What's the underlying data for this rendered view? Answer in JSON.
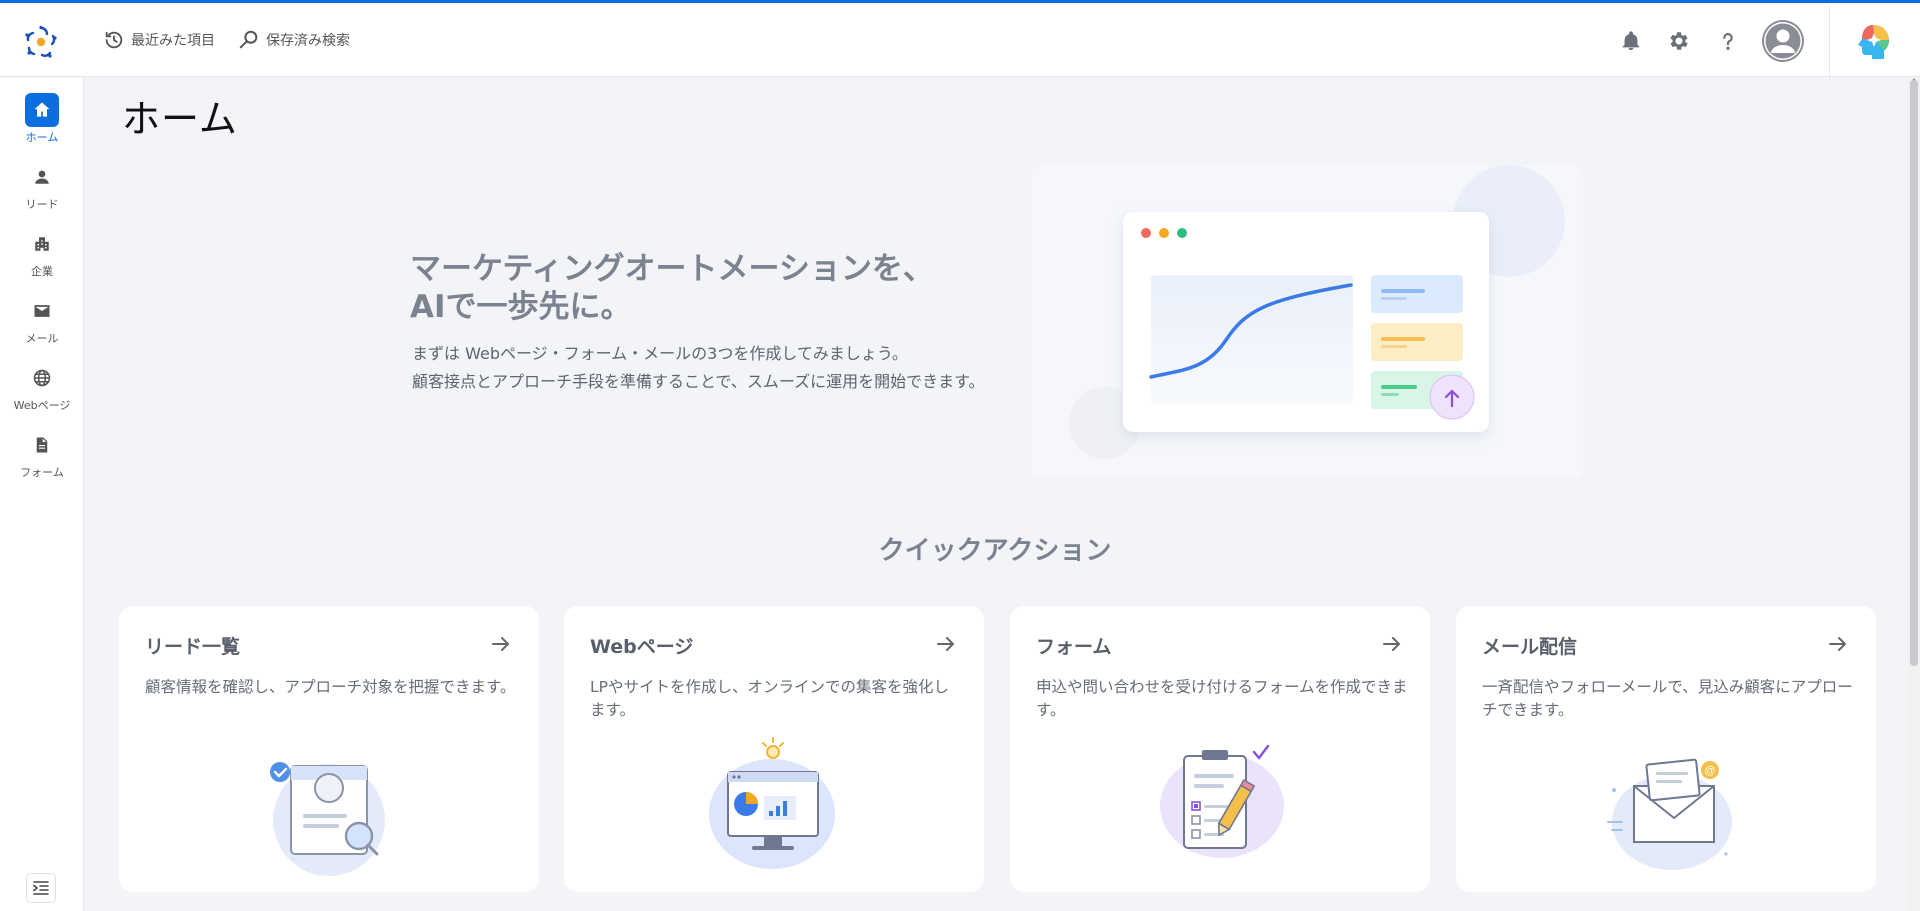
{
  "topbar": {
    "recent_label": "最近みた項目",
    "saved_search_label": "保存済み検索"
  },
  "sidebar": {
    "items": [
      {
        "label": "ホーム",
        "icon": "home-icon"
      },
      {
        "label": "リード",
        "icon": "person-icon"
      },
      {
        "label": "企業",
        "icon": "building-icon"
      },
      {
        "label": "メール",
        "icon": "mail-icon"
      },
      {
        "label": "Webページ",
        "icon": "globe-icon"
      },
      {
        "label": "フォーム",
        "icon": "document-icon"
      }
    ]
  },
  "page": {
    "title": "ホーム"
  },
  "hero": {
    "title_line1": "マーケティングオートメーションを、",
    "title_line2": "AIで一歩先に。",
    "desc_line1": "まずは Webページ・フォーム・メールの3つを作成してみましょう。",
    "desc_line2": "顧客接点とアプローチ手段を準備することで、スムーズに運用を開始できます。"
  },
  "quick_actions": {
    "title": "クイックアクション",
    "cards": [
      {
        "title": "リード一覧",
        "desc": "顧客情報を確認し、アプローチ対象を把握できます。"
      },
      {
        "title": "Webページ",
        "desc": "LPやサイトを作成し、オンラインでの集客を強化します。"
      },
      {
        "title": "フォーム",
        "desc": "申込や問い合わせを受け付けるフォームを作成できます。"
      },
      {
        "title": "メール配信",
        "desc": "一斉配信やフォローメールで、見込み顧客にアプローチできます。"
      }
    ]
  },
  "colors": {
    "accent": "#0b6ee0",
    "background": "#f3f4f8",
    "heading_gray": "#7b8290"
  }
}
